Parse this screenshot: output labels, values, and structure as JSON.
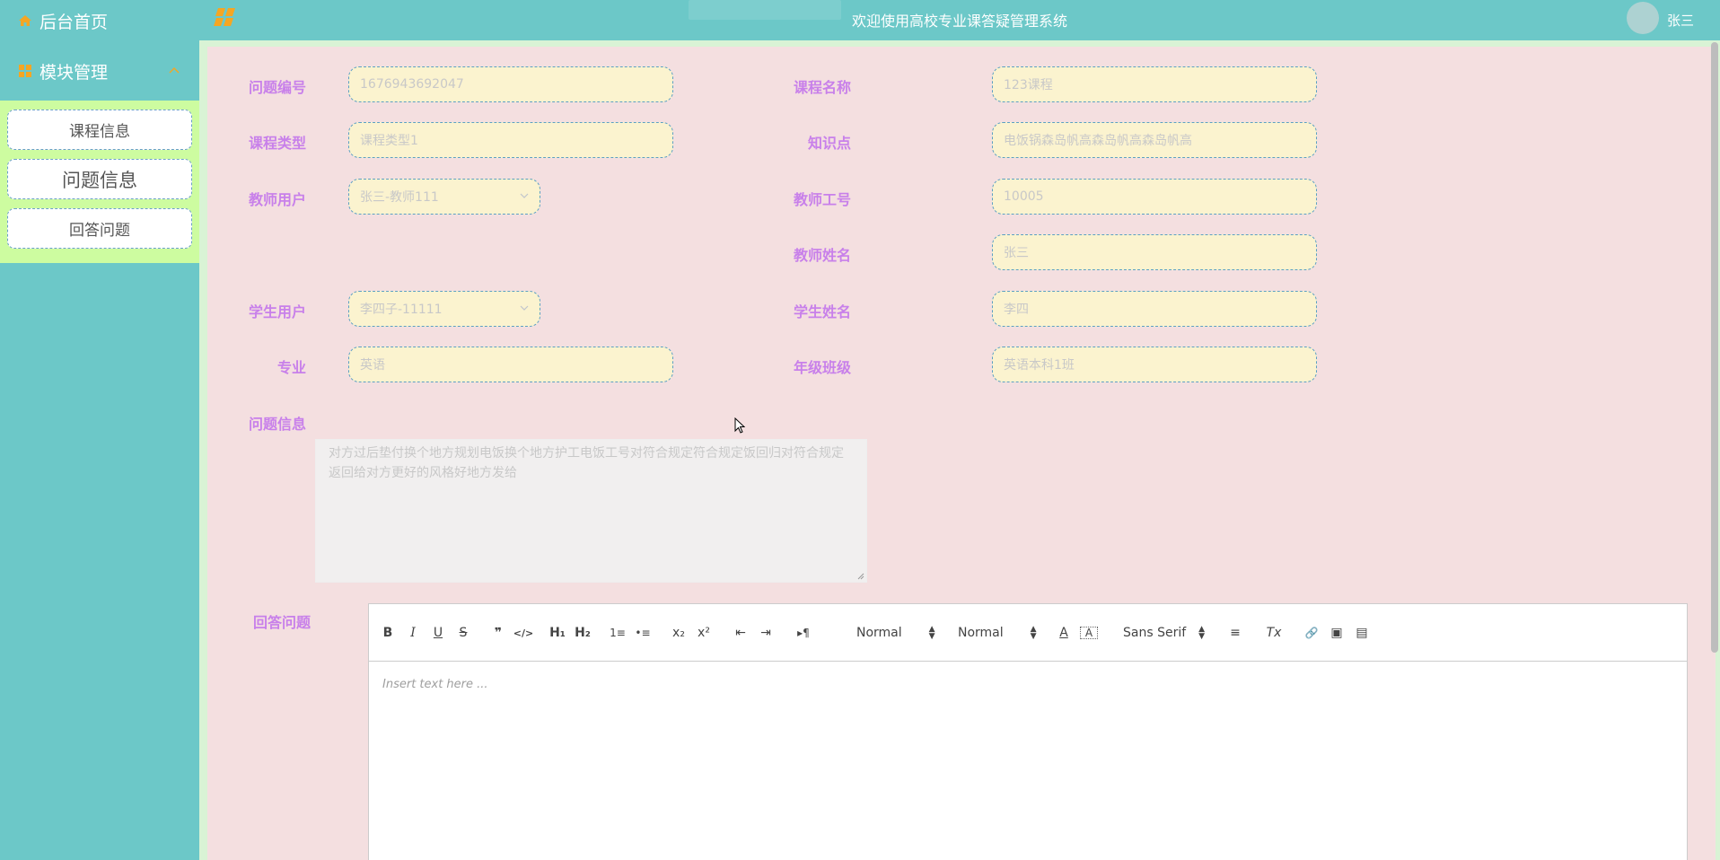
{
  "sidebar": {
    "home_label": "后台首页",
    "module_label": "模块管理",
    "items": [
      {
        "label": "课程信息"
      },
      {
        "label": "问题信息"
      },
      {
        "label": "回答问题"
      }
    ]
  },
  "header": {
    "title": "欢迎使用高校专业课答疑管理系统",
    "username": "张三"
  },
  "form": {
    "question_no": {
      "label": "问题编号",
      "value": "1676943692047"
    },
    "course_name": {
      "label": "课程名称",
      "value": "123课程"
    },
    "course_type": {
      "label": "课程类型",
      "value": "课程类型1"
    },
    "knowledge": {
      "label": "知识点",
      "value": "电饭锅森岛帆高森岛帆高森岛帆高"
    },
    "teacher_user": {
      "label": "教师用户",
      "value": "张三-教师111"
    },
    "teacher_no": {
      "label": "教师工号",
      "value": "10005"
    },
    "teacher_name": {
      "label": "教师姓名",
      "value": "张三"
    },
    "student_user": {
      "label": "学生用户",
      "value": "李四子-11111"
    },
    "student_name": {
      "label": "学生姓名",
      "value": "李四"
    },
    "major": {
      "label": "专业",
      "value": "英语"
    },
    "grade_class": {
      "label": "年级班级",
      "value": "英语本科1班"
    },
    "question_info": {
      "label": "问题信息",
      "value": "对方过后垫付换个地方规划电饭换个地方护工电饭工号对符合规定符合规定饭回归对符合规定返回给对方更好的风格好地方发给"
    },
    "answer": {
      "label": "回答问题",
      "placeholder": "Insert text here ..."
    }
  },
  "toolbar": {
    "bold": "B",
    "italic": "I",
    "underline": "U",
    "strike": "S",
    "quote": "❞",
    "code": "</>",
    "h1": "H₁",
    "h2": "H₂",
    "ordered_list": "1≡",
    "bullet_list": "•≡",
    "subscript": "x₂",
    "superscript": "x²",
    "outdent": "⇤",
    "indent": "⇥",
    "direction": "▸¶",
    "size_picker": "Normal",
    "header_picker": "Normal",
    "color": "A",
    "background": "A",
    "font_picker": "Sans Serif",
    "align": "≡",
    "clean": "Tx",
    "link": "🔗",
    "image": "▣",
    "video": "▤"
  },
  "colors": {
    "sidebar_bg": "#6cc8c8",
    "submenu_bg": "#cdfca0",
    "panel_bg": "#f4dfe0",
    "label": "#c880ea",
    "input_bg": "#fbf3cf",
    "icon_orange": "#f5a623"
  }
}
